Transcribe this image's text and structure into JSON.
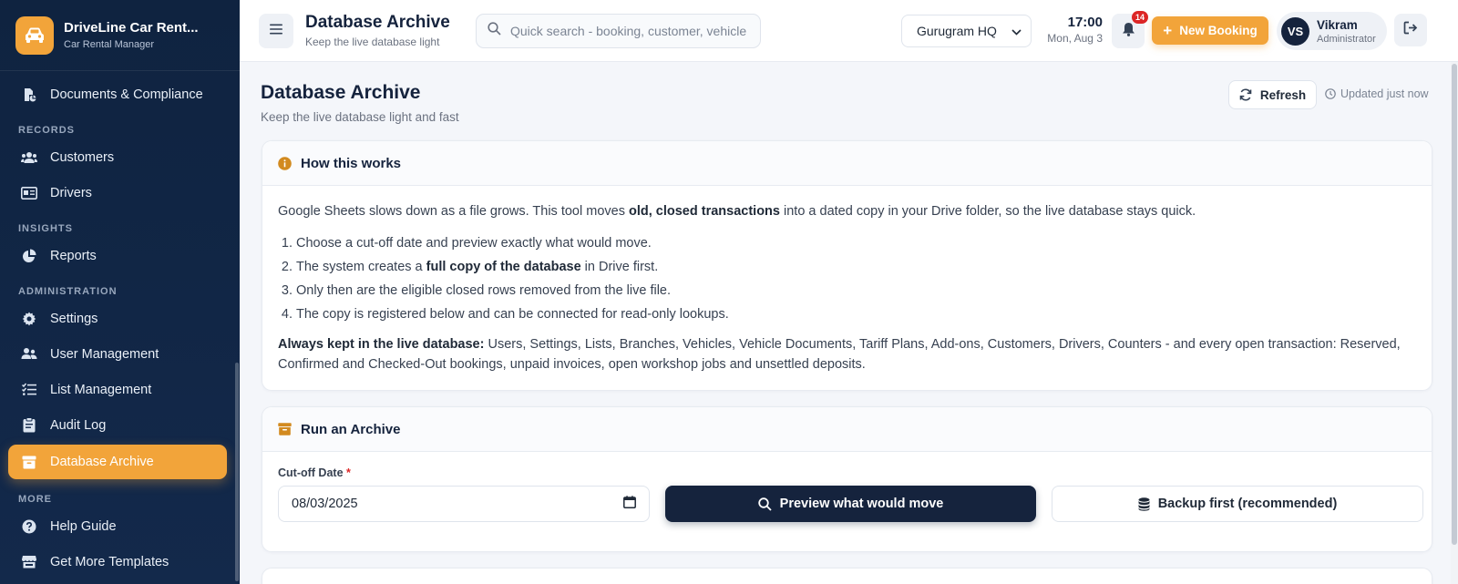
{
  "app": {
    "name": "DriveLine Car Rent...",
    "subtitle": "Car Rental Manager"
  },
  "sidebar": {
    "items": [
      {
        "label": "Documents & Compliance",
        "icon": "documents-icon"
      },
      {
        "section": "RECORDS"
      },
      {
        "label": "Customers",
        "icon": "users-icon"
      },
      {
        "label": "Drivers",
        "icon": "id-card-icon"
      },
      {
        "section": "INSIGHTS"
      },
      {
        "label": "Reports",
        "icon": "pie-chart-icon"
      },
      {
        "section": "ADMINISTRATION"
      },
      {
        "label": "Settings",
        "icon": "gear-icon"
      },
      {
        "label": "User Management",
        "icon": "user-management-icon"
      },
      {
        "label": "List Management",
        "icon": "list-check-icon"
      },
      {
        "label": "Audit Log",
        "icon": "clipboard-icon"
      },
      {
        "label": "Database Archive",
        "icon": "archive-icon",
        "active": true
      },
      {
        "section": "MORE"
      },
      {
        "label": "Help Guide",
        "icon": "help-icon"
      },
      {
        "label": "Get More Templates",
        "icon": "store-icon"
      }
    ]
  },
  "topbar": {
    "title": "Database Archive",
    "subtitle": "Keep the live database light",
    "search_placeholder": "Quick search - booking, customer, vehicle",
    "branch": "Gurugram HQ",
    "time": "17:00",
    "date": "Mon, Aug 3",
    "notifications": "14",
    "new_booking": "New Booking",
    "user": {
      "initials": "VS",
      "name": "Vikram",
      "role": "Administrator"
    }
  },
  "page": {
    "title": "Database Archive",
    "subtitle": "Keep the live database light and fast",
    "refresh": "Refresh",
    "updated": "Updated just now"
  },
  "how_it_works": {
    "title": "How this works",
    "intro_a": "Google Sheets slows down as a file grows. This tool moves ",
    "intro_b": "old, closed transactions",
    "intro_c": " into a dated copy in your Drive folder, so the live database stays quick.",
    "step1": "Choose a cut-off date and preview exactly what would move.",
    "step2_a": "The system creates a ",
    "step2_b": "full copy of the database",
    "step2_c": " in Drive first.",
    "step3": "Only then are the eligible closed rows removed from the live file.",
    "step4": "The copy is registered below and can be connected for read-only lookups.",
    "kept_label": "Always kept in the live database:",
    "kept_text": " Users, Settings, Lists, Branches, Vehicles, Vehicle Documents, Tariff Plans, Add-ons, Customers, Drivers, Counters - and every open transaction: Reserved, Confirmed and Checked-Out bookings, unpaid invoices, open workshop jobs and unsettled deposits."
  },
  "run_archive": {
    "title": "Run an Archive",
    "cutoff_label": "Cut-off Date",
    "required_mark": "*",
    "cutoff_value": "08/03/2025",
    "preview_button": "Preview what would move",
    "backup_button": "Backup first (recommended)"
  },
  "colors": {
    "accent": "#f2a43a",
    "navy": "#15233d",
    "sidebar_bg": "#0f2340"
  }
}
